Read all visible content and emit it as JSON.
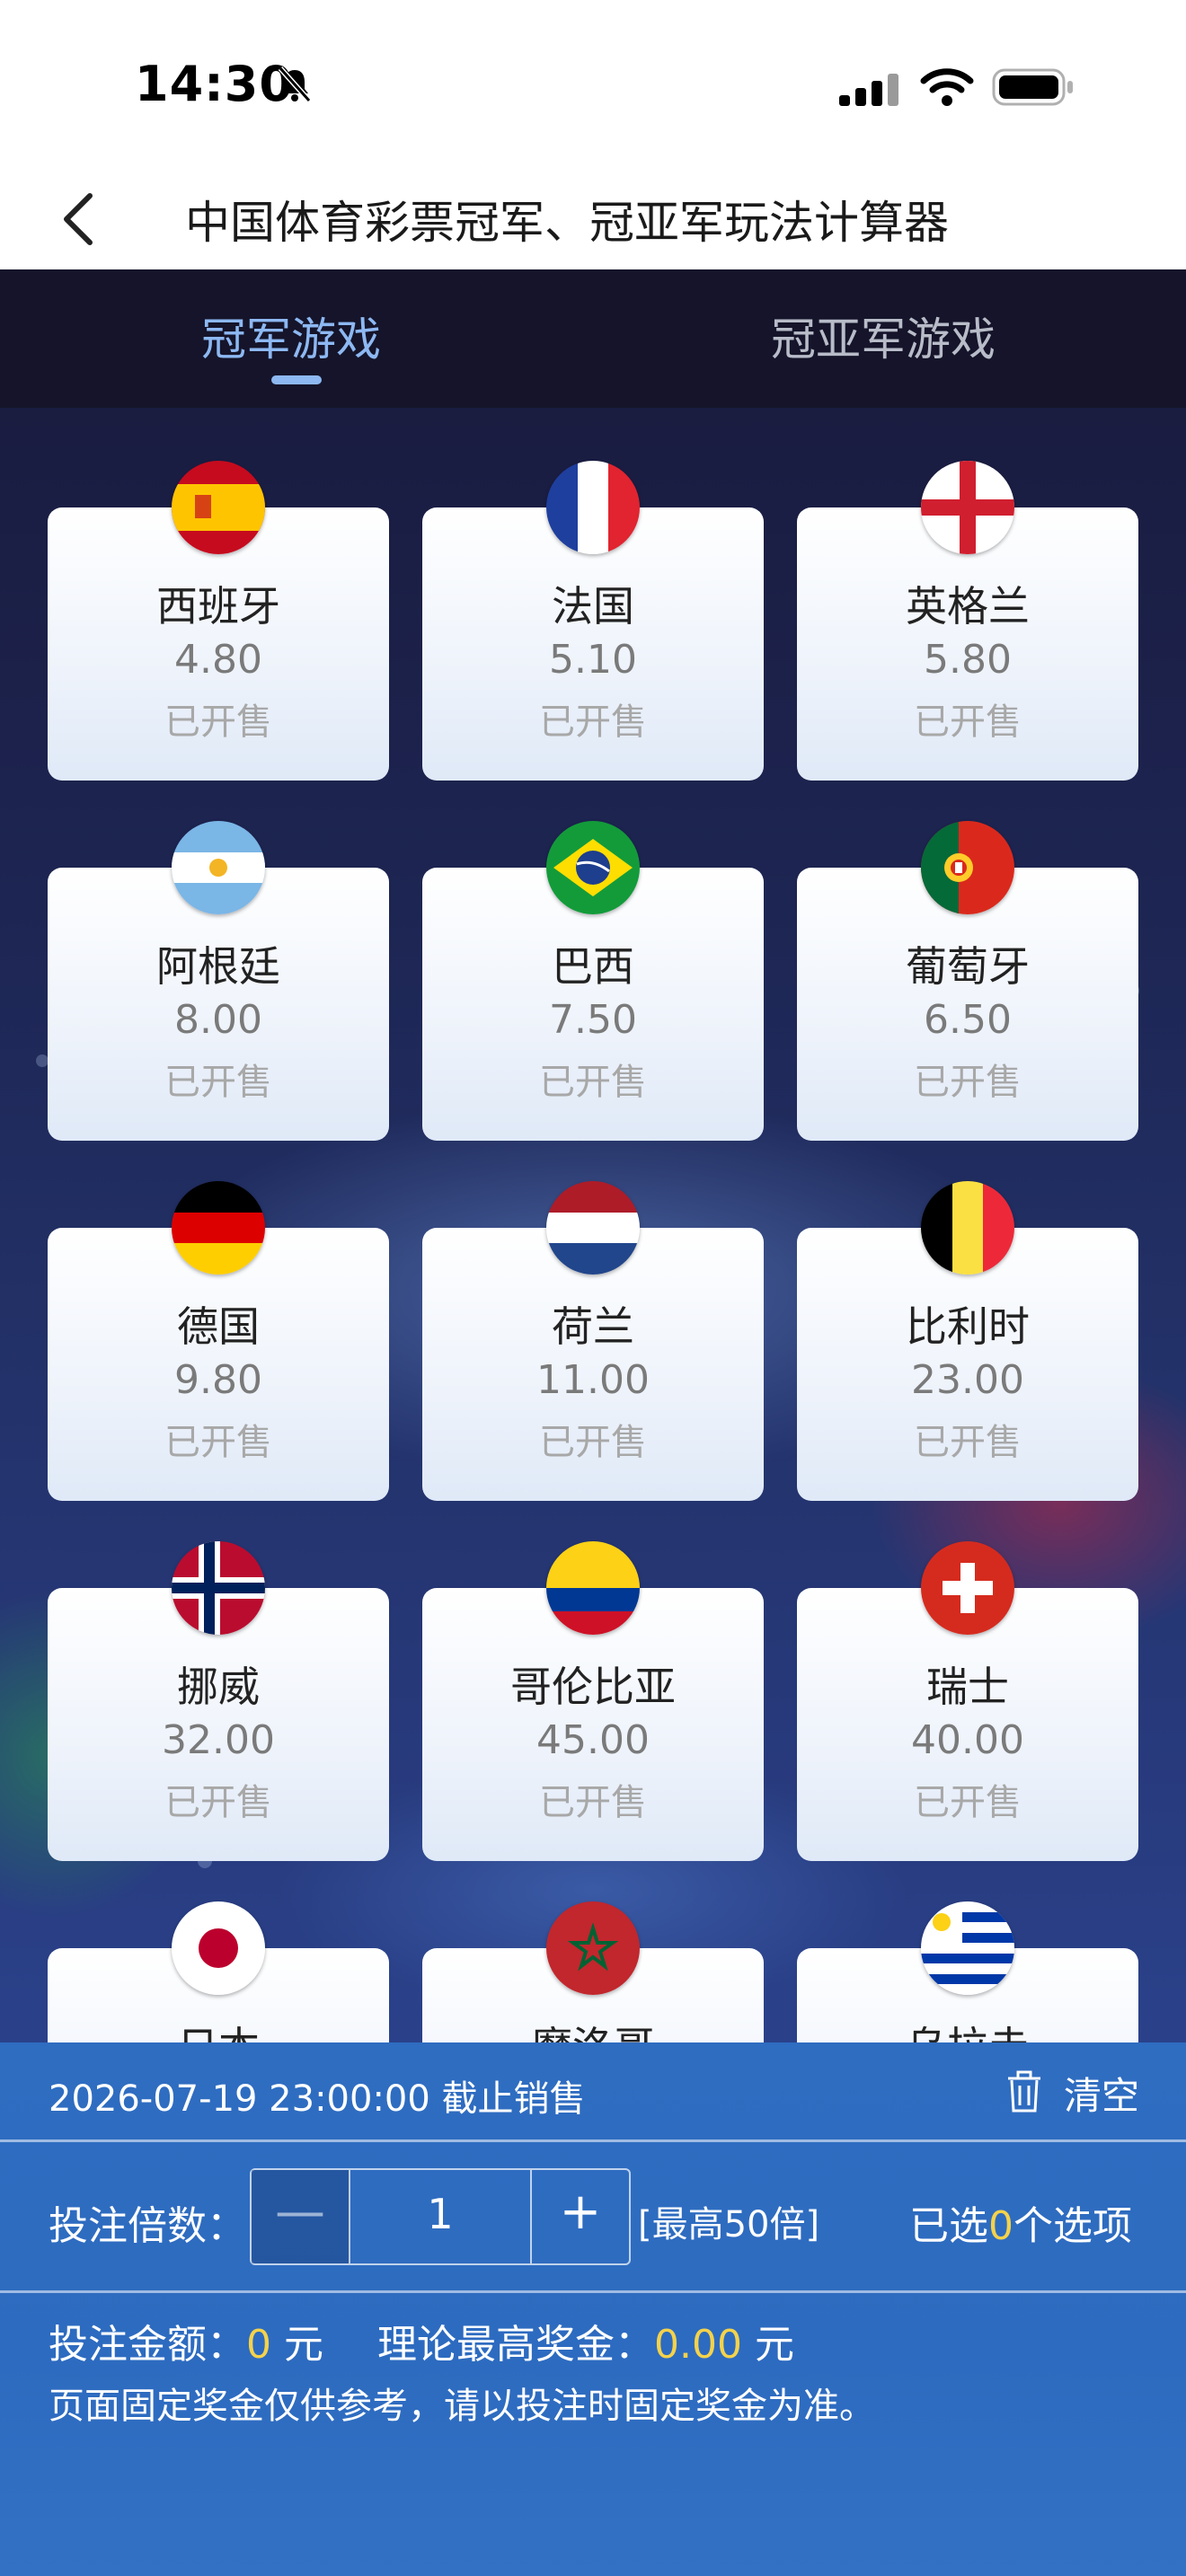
{
  "status_bar": {
    "time": "14:30"
  },
  "header": {
    "title": "中国体育彩票冠军、冠亚军玩法计算器"
  },
  "tabs": [
    {
      "label": "冠军游戏",
      "active": true
    },
    {
      "label": "冠亚军游戏",
      "active": false
    }
  ],
  "teams": [
    {
      "name": "西班牙",
      "odds": "4.80",
      "status": "已开售",
      "flag": "spain-flag-icon"
    },
    {
      "name": "法国",
      "odds": "5.10",
      "status": "已开售",
      "flag": "france-flag-icon"
    },
    {
      "name": "英格兰",
      "odds": "5.80",
      "status": "已开售",
      "flag": "england-flag-icon"
    },
    {
      "name": "阿根廷",
      "odds": "8.00",
      "status": "已开售",
      "flag": "argentina-flag-icon"
    },
    {
      "name": "巴西",
      "odds": "7.50",
      "status": "已开售",
      "flag": "brazil-flag-icon"
    },
    {
      "name": "葡萄牙",
      "odds": "6.50",
      "status": "已开售",
      "flag": "portugal-flag-icon"
    },
    {
      "name": "德国",
      "odds": "9.80",
      "status": "已开售",
      "flag": "germany-flag-icon"
    },
    {
      "name": "荷兰",
      "odds": "11.00",
      "status": "已开售",
      "flag": "netherlands-flag-icon"
    },
    {
      "name": "比利时",
      "odds": "23.00",
      "status": "已开售",
      "flag": "belgium-flag-icon"
    },
    {
      "name": "挪威",
      "odds": "32.00",
      "status": "已开售",
      "flag": "norway-flag-icon"
    },
    {
      "name": "哥伦比亚",
      "odds": "45.00",
      "status": "已开售",
      "flag": "colombia-flag-icon"
    },
    {
      "name": "瑞士",
      "odds": "40.00",
      "status": "已开售",
      "flag": "switzerland-flag-icon"
    },
    {
      "name": "日本",
      "odds": "",
      "status": "",
      "flag": "japan-flag-icon"
    },
    {
      "name": "摩洛哥",
      "odds": "",
      "status": "",
      "flag": "morocco-flag-icon"
    },
    {
      "name": "乌拉圭",
      "odds": "",
      "status": "",
      "flag": "uruguay-flag-icon"
    }
  ],
  "panel": {
    "deadline": "2026-07-19 23:00:00 截止销售",
    "clear_label": "清空",
    "multiplier_label": "投注倍数：",
    "minus": "—",
    "multiplier_value": "1",
    "plus": "+",
    "max_note": "[最高50倍]",
    "selected_prefix": "已选",
    "selected_count": "0",
    "selected_suffix": "个选项",
    "amount_label": "投注金额：",
    "amount_value": "0",
    "amount_unit": "元",
    "max_prize_label": "理论最高奖金：",
    "max_prize_value": "0.00",
    "max_prize_unit": "元",
    "notice": "页面固定奖金仅供参考，请以投注时固定奖金为准。"
  },
  "colors": {
    "tab_active": "#8db8f2",
    "tab_bar_bg": "#15142a",
    "panel_bg": "#2f6ec1",
    "highlight": "#f4d24b"
  }
}
